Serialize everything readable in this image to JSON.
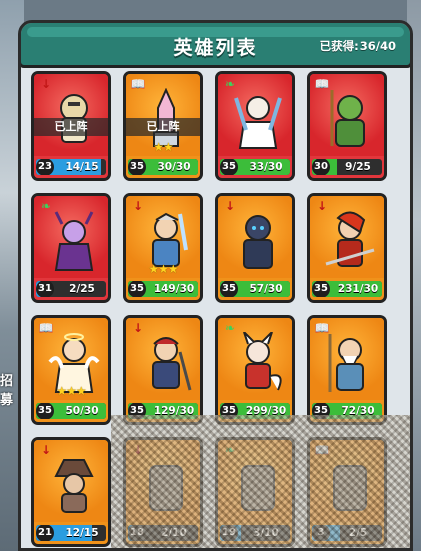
{
  "header": {
    "title": "英雄列表",
    "owned_label": "已获得:",
    "owned_value": "36/40"
  },
  "side_text": "招募",
  "deployed_label": "已上阵",
  "heroes": [
    {
      "color": "red",
      "badge": "arrow",
      "deployed": true,
      "level": "23",
      "count": "14/15",
      "bar": "blue",
      "progress": 0.93,
      "stars": "",
      "hero": "golden-knight"
    },
    {
      "color": "orange",
      "badge": "book",
      "deployed": true,
      "level": "35",
      "count": "30/30",
      "bar": "green",
      "progress": 1.0,
      "stars": "★★",
      "hero": "rocket-robot"
    },
    {
      "color": "red",
      "badge": "leaf",
      "deployed": false,
      "level": "35",
      "count": "33/30",
      "bar": "green",
      "progress": 1.0,
      "stars": "",
      "hero": "white-fox-swordmaster"
    },
    {
      "color": "red",
      "badge": "book",
      "deployed": false,
      "level": "30",
      "count": "9/25",
      "bar": "green",
      "progress": 0.36,
      "stars": "",
      "hero": "green-druid"
    },
    {
      "color": "red",
      "badge": "leaf",
      "deployed": false,
      "level": "31",
      "count": "2/25",
      "bar": "blue",
      "progress": 0.08,
      "stars": "",
      "hero": "purple-demon"
    },
    {
      "color": "orange",
      "badge": "arrow",
      "deployed": false,
      "level": "35",
      "count": "149/30",
      "bar": "green",
      "progress": 1.0,
      "stars": "★★★",
      "hero": "silver-swordsman"
    },
    {
      "color": "orange",
      "badge": "arrow",
      "deployed": false,
      "level": "35",
      "count": "57/30",
      "bar": "green",
      "progress": 1.0,
      "stars": "",
      "hero": "dark-knight"
    },
    {
      "color": "orange",
      "badge": "arrow",
      "deployed": false,
      "level": "35",
      "count": "231/30",
      "bar": "green",
      "progress": 1.0,
      "stars": "",
      "hero": "red-ninja"
    },
    {
      "color": "orange",
      "badge": "book",
      "deployed": false,
      "level": "35",
      "count": "50/30",
      "bar": "green",
      "progress": 1.0,
      "stars": "★★★",
      "hero": "angel"
    },
    {
      "color": "orange",
      "badge": "arrow",
      "deployed": false,
      "level": "35",
      "count": "129/30",
      "bar": "green",
      "progress": 1.0,
      "stars": "",
      "hero": "red-samurai"
    },
    {
      "color": "orange",
      "badge": "leaf",
      "deployed": false,
      "level": "35",
      "count": "299/30",
      "bar": "green",
      "progress": 1.0,
      "stars": "",
      "hero": "fox-girl"
    },
    {
      "color": "orange",
      "badge": "book",
      "deployed": false,
      "level": "35",
      "count": "72/30",
      "bar": "green",
      "progress": 1.0,
      "stars": "",
      "hero": "old-sage"
    },
    {
      "color": "orange",
      "badge": "arrow",
      "deployed": false,
      "level": "21",
      "count": "12/15",
      "bar": "blue",
      "progress": 0.8,
      "stars": "",
      "hero": "hat-mage"
    },
    {
      "color": "orange",
      "badge": "arrow",
      "deployed": false,
      "level": "18",
      "count": "2/10",
      "bar": "blue",
      "progress": 0.2,
      "stars": "",
      "hero": "hidden"
    },
    {
      "color": "orange",
      "badge": "leaf",
      "deployed": false,
      "level": "19",
      "count": "3/10",
      "bar": "blue",
      "progress": 0.3,
      "stars": "",
      "hero": "hidden"
    },
    {
      "color": "orange",
      "badge": "book",
      "deployed": false,
      "level": "3",
      "count": "2/5",
      "bar": "blue",
      "progress": 0.4,
      "stars": "",
      "hero": "hidden"
    }
  ],
  "colors": {
    "header": "#2a7f73",
    "red_card": "#e2363c",
    "orange_card": "#f0921a",
    "blue_bar": "#2b9de0",
    "green_bar": "#3cbd3a"
  }
}
